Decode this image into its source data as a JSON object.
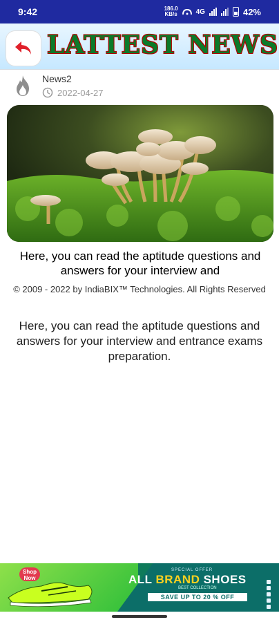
{
  "status_bar": {
    "time": "9:42",
    "speed_value": "186.0",
    "speed_unit": "KB/s",
    "network": "4G",
    "battery": "42%"
  },
  "header": {
    "title": "LATTEST NEWS",
    "back_icon": "back-arrow-icon",
    "title_color": "#0b7a2a",
    "title_outline": "#b30000"
  },
  "article": {
    "title": "News2",
    "date": "2022-04-27",
    "category_icon": "fire-icon",
    "lead": "Here, you can read the aptitude questions and answers for your interview and",
    "copyright": "© 2009 - 2022 by IndiaBIX™ Technologies. All Rights Reserved",
    "body": "Here, you can read the aptitude questions and answers for your interview and entrance exams preparation."
  },
  "ad": {
    "shop_now": "Shop Now",
    "special_offer": "SPECIAL OFFER",
    "headline_part1": "ALL ",
    "headline_brand": "BRAND",
    "headline_part2": " SHOES",
    "best_collection": "BEST COLLECTION",
    "save_text": "SAVE UP TO 20 % OFF"
  }
}
